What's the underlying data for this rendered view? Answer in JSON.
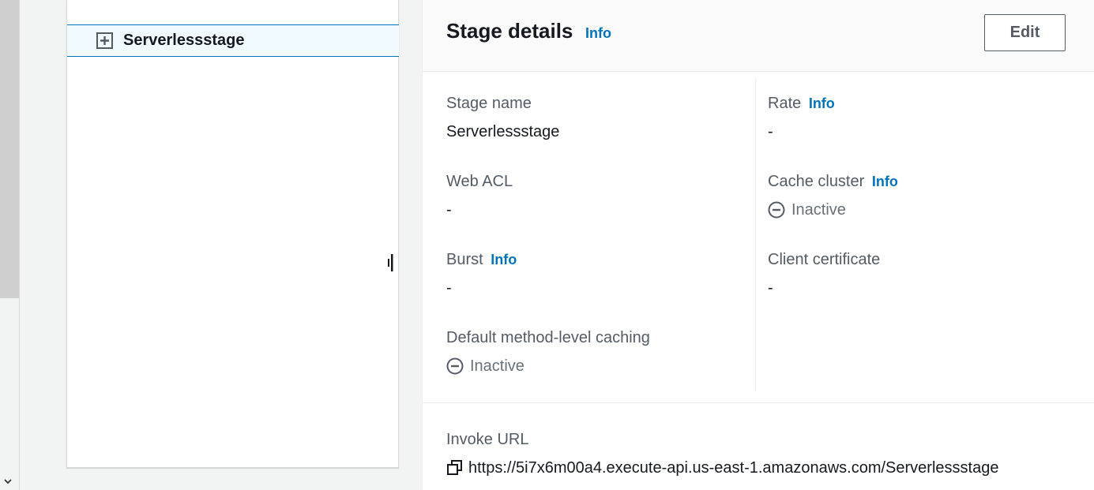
{
  "tree": {
    "selected_stage": "Serverlessstage",
    "expand_icon": "plus-square-icon"
  },
  "details": {
    "title": "Stage details",
    "info_label": "Info",
    "edit_label": "Edit",
    "fields": {
      "stage_name": {
        "label": "Stage name",
        "value": "Serverlessstage"
      },
      "rate": {
        "label": "Rate",
        "info": "Info",
        "value": "-"
      },
      "web_acl": {
        "label": "Web ACL",
        "value": "-"
      },
      "cache_cluster": {
        "label": "Cache cluster",
        "info": "Info",
        "value": "Inactive"
      },
      "burst": {
        "label": "Burst",
        "info": "Info",
        "value": "-"
      },
      "client_certificate": {
        "label": "Client certificate",
        "value": "-"
      },
      "default_caching": {
        "label": "Default method-level caching",
        "value": "Inactive"
      }
    },
    "invoke": {
      "label": "Invoke URL",
      "url": "https://5i7x6m00a4.execute-api.us-east-1.amazonaws.com/Serverlessstage"
    }
  },
  "colors": {
    "link": "#0073bb",
    "selected_bg": "#f1faff",
    "text": "#16191f",
    "label": "#545b64"
  }
}
